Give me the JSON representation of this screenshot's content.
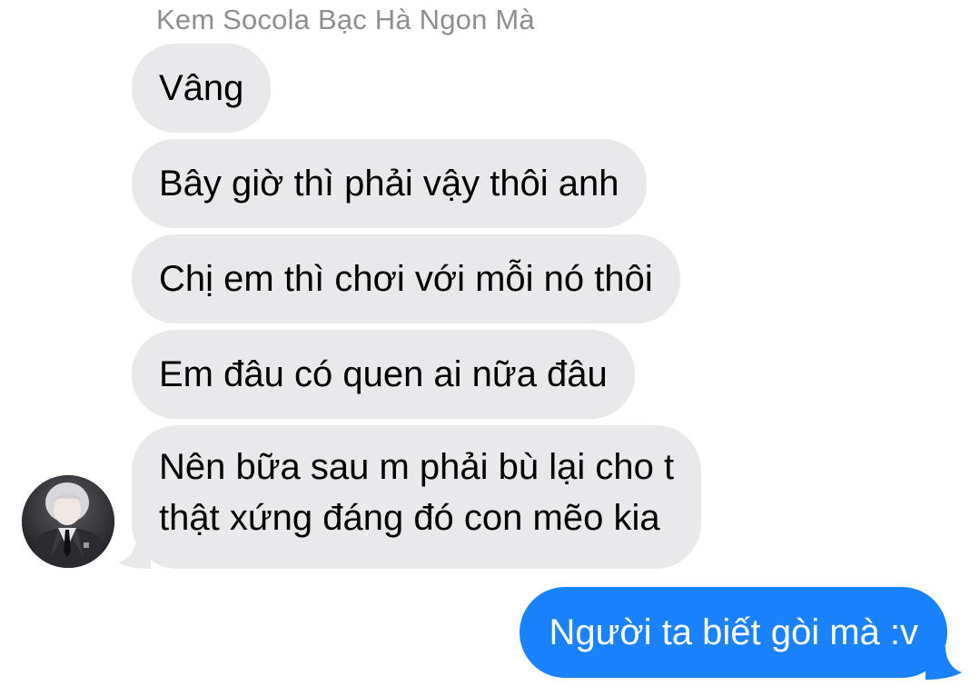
{
  "thread": {
    "sender_name": "Kem Socola Bạc Hà Ngon Mà",
    "incoming": [
      {
        "text": "Vâng"
      },
      {
        "text": "Bây giờ thì phải vậy thôi anh"
      },
      {
        "text": "Chị em thì chơi với mỗi nó thôi"
      },
      {
        "text": "Em đâu có quen ai nữa đâu"
      },
      {
        "lines": [
          "Nên bữa sau m phải bù lại cho t",
          "thật xứng đáng đó con mẽo kia"
        ]
      }
    ],
    "outgoing": [
      {
        "text": "Người ta biết gòi mà :v"
      }
    ]
  },
  "colors": {
    "incoming_bubble": "#e9e9eb",
    "outgoing_bubble": "#1982fc",
    "sender_name": "#8e8e93",
    "outgoing_text": "#ffffff",
    "incoming_text": "#000000"
  },
  "icons": {
    "avatar": "contact-avatar-photo"
  }
}
